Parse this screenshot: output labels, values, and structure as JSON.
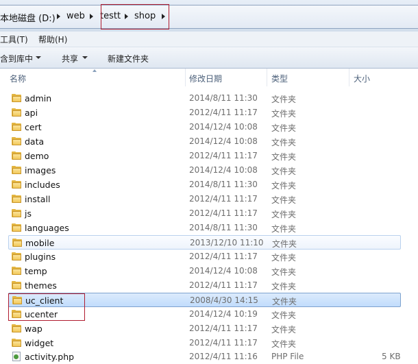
{
  "address": {
    "crumbs": [
      "本地磁盘 (D:)",
      "web",
      "testt",
      "shop"
    ],
    "highlight_color": "#b01b2e"
  },
  "menu": [
    "工具(T)",
    "帮助(H)"
  ],
  "toolbar": {
    "include_label": "含到库中",
    "share_label": "共享",
    "new_folder_label": "新建文件夹"
  },
  "columns": {
    "name": "名称",
    "modified": "修改日期",
    "type": "类型",
    "size": "大小"
  },
  "rows": [
    {
      "name": "admin",
      "date": "2014/8/11 11:30",
      "type": "文件夹",
      "size": ""
    },
    {
      "name": "api",
      "date": "2012/4/11 11:17",
      "type": "文件夹",
      "size": ""
    },
    {
      "name": "cert",
      "date": "2014/12/4 10:08",
      "type": "文件夹",
      "size": ""
    },
    {
      "name": "data",
      "date": "2014/12/4 10:08",
      "type": "文件夹",
      "size": ""
    },
    {
      "name": "demo",
      "date": "2012/4/11 11:17",
      "type": "文件夹",
      "size": ""
    },
    {
      "name": "images",
      "date": "2014/12/4 10:08",
      "type": "文件夹",
      "size": ""
    },
    {
      "name": "includes",
      "date": "2014/8/11 11:30",
      "type": "文件夹",
      "size": ""
    },
    {
      "name": "install",
      "date": "2012/4/11 11:17",
      "type": "文件夹",
      "size": ""
    },
    {
      "name": "js",
      "date": "2012/4/11 11:17",
      "type": "文件夹",
      "size": ""
    },
    {
      "name": "languages",
      "date": "2014/8/11 11:30",
      "type": "文件夹",
      "size": ""
    },
    {
      "name": "mobile",
      "date": "2013/12/10 11:10",
      "type": "文件夹",
      "size": ""
    },
    {
      "name": "plugins",
      "date": "2012/4/11 11:17",
      "type": "文件夹",
      "size": ""
    },
    {
      "name": "temp",
      "date": "2014/12/4 10:08",
      "type": "文件夹",
      "size": ""
    },
    {
      "name": "themes",
      "date": "2012/4/11 11:17",
      "type": "文件夹",
      "size": ""
    },
    {
      "name": "uc_client",
      "date": "2008/4/30 14:15",
      "type": "文件夹",
      "size": ""
    },
    {
      "name": "ucenter",
      "date": "2014/12/4 10:19",
      "type": "文件夹",
      "size": ""
    },
    {
      "name": "wap",
      "date": "2012/4/11 11:17",
      "type": "文件夹",
      "size": ""
    },
    {
      "name": "widget",
      "date": "2012/4/11 11:17",
      "type": "文件夹",
      "size": ""
    },
    {
      "name": "activity.php",
      "date": "2012/4/11 11:16",
      "type": "PHP File",
      "size": "5 KB"
    }
  ]
}
